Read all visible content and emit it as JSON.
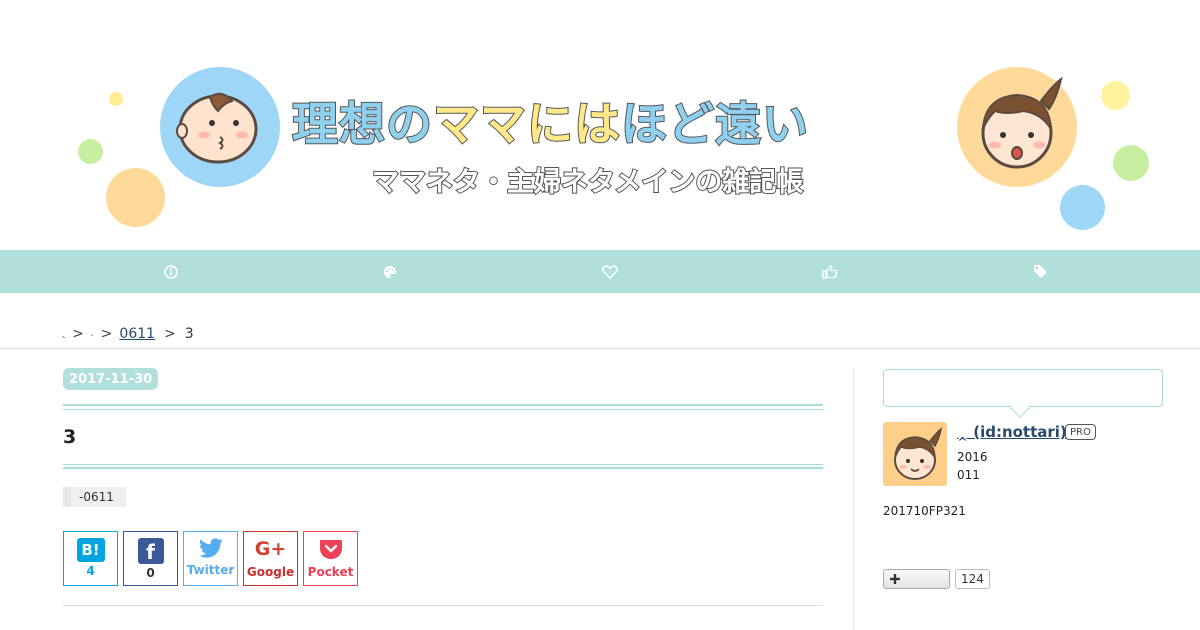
{
  "header": {
    "title_blue_1": "理想の",
    "title_yellow": "ママには",
    "title_blue_2": "ほど遠い",
    "subtitle": "ママネタ・主婦ネタメインの雑記帳",
    "colors": {
      "blue": "#8fd0ee",
      "yellow": "#ffe88a",
      "orange": "#ffcf89",
      "green": "#c4ef9a"
    }
  },
  "nav": {
    "background": "#b1dfdb",
    "items": [
      {
        "icon": "info-icon"
      },
      {
        "icon": "palette-icon"
      },
      {
        "icon": "heart-icon"
      },
      {
        "icon": "thumbs-up-icon"
      },
      {
        "icon": "tag-icon"
      }
    ]
  },
  "breadcrumb": {
    "item1": "‸",
    "sep": ">",
    "item2": ".",
    "item3": "0611",
    "current": "3"
  },
  "entry": {
    "date": "2017-11-30",
    "title": "3",
    "category": "-0611"
  },
  "share": {
    "hatena_logo": "B!",
    "hatena_count": "4",
    "facebook_logo": "f",
    "facebook_count": "0",
    "twitter_label": "Twitter",
    "google_logo": "G+",
    "google_label": "Google",
    "pocket_label": "Pocket"
  },
  "sidebar": {
    "profile_name": "‸ (id:nottari)",
    "pro_badge": "PRO",
    "line1": "2016",
    "line2": "011",
    "description": "201710FP321",
    "follow_count": "124"
  }
}
